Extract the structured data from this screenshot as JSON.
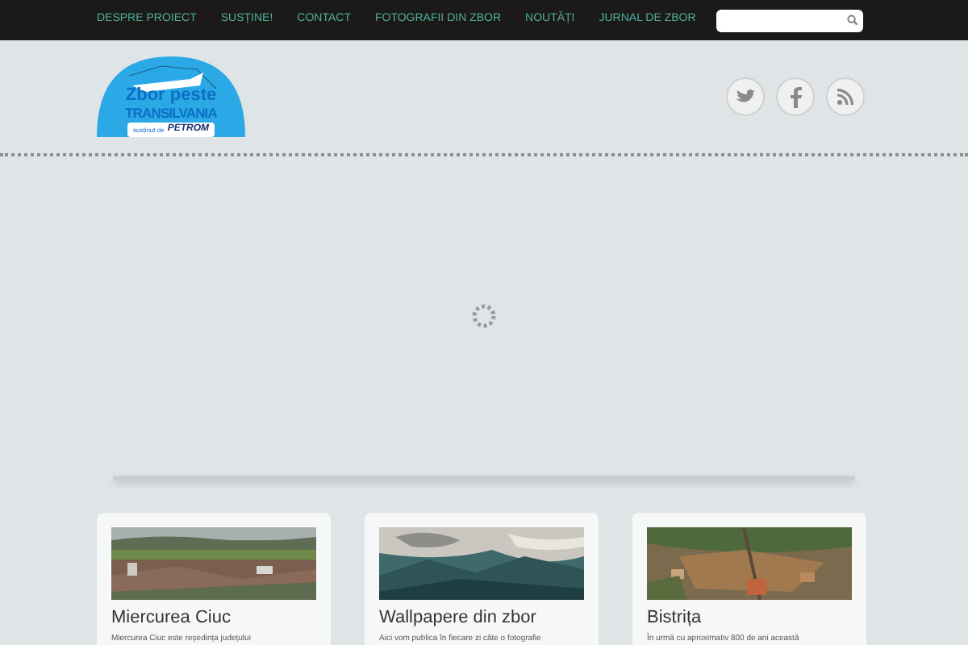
{
  "nav": {
    "items": [
      {
        "label": "DESPRE PROIECT"
      },
      {
        "label": "SUSȚINE!"
      },
      {
        "label": "CONTACT"
      },
      {
        "label": "FOTOGRAFII DIN ZBOR"
      },
      {
        "label": "NOUTĂȚI"
      },
      {
        "label": "JURNAL DE ZBOR"
      }
    ]
  },
  "logo": {
    "line_1": "Zbor peste",
    "line_2": "TRANSILVANIA",
    "sponsor_prefix": "susținut de",
    "sponsor": "PETROM"
  },
  "cards": [
    {
      "title": "Miercurea Ciuc",
      "excerpt": "Miercurea Ciuc este reședința județului",
      "kind": "picture"
    },
    {
      "title": "Wallpapere din zbor",
      "excerpt": "Aici vom publica în fiecare zi câte o fotografie",
      "kind": "picture"
    },
    {
      "title": "Bistrița",
      "excerpt": "În urmă cu aproximativ 800 de ani această",
      "kind": "picture"
    }
  ]
}
